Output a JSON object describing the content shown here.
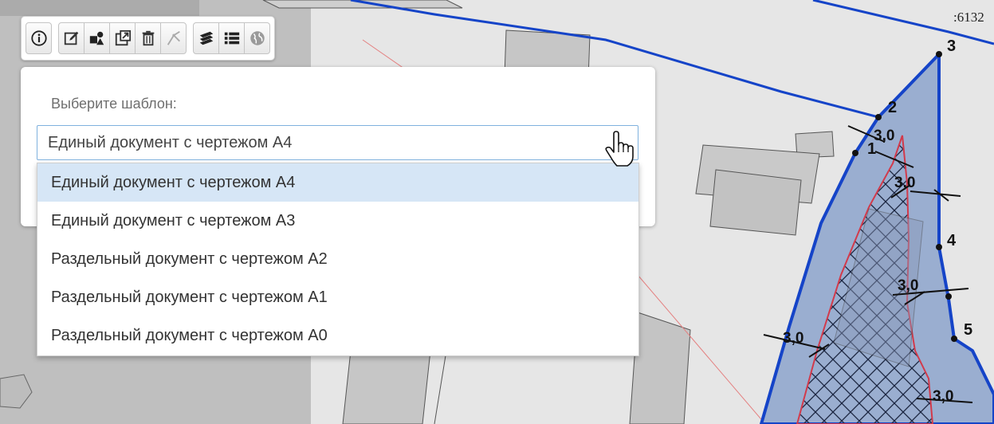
{
  "toolbar": {
    "buttons": [
      {
        "icon": "info-icon"
      },
      {
        "icon": "edit-icon"
      },
      {
        "icon": "shapes-icon"
      },
      {
        "icon": "external-link-icon"
      },
      {
        "icon": "trash-icon"
      },
      {
        "icon": "measure-icon"
      },
      {
        "icon": "layers-icon"
      },
      {
        "icon": "list-icon"
      },
      {
        "icon": "globe-icon"
      }
    ]
  },
  "template_panel": {
    "label": "Выберите шаблон:",
    "selected_value": "Единый документ с чертежом А4"
  },
  "dropdown": {
    "options": [
      "Единый документ с чертежом А4",
      "Единый документ с чертежом А3",
      "Раздельный документ с чертежом А2",
      "Раздельный документ с чертежом А1",
      "Раздельный документ с чертежом А0"
    ],
    "highlighted_index": 0
  },
  "map": {
    "parcel_number": ":6132",
    "point_labels": [
      "1",
      "2",
      "3",
      "4",
      "5"
    ],
    "dimension_label": "3,0"
  },
  "colors": {
    "boundary_blue": "#1544c8",
    "parcel_fill": "#9aaed0",
    "redline": "#d23a4b",
    "option_highlight": "#d6e6f6",
    "input_border": "#7fb1de"
  }
}
